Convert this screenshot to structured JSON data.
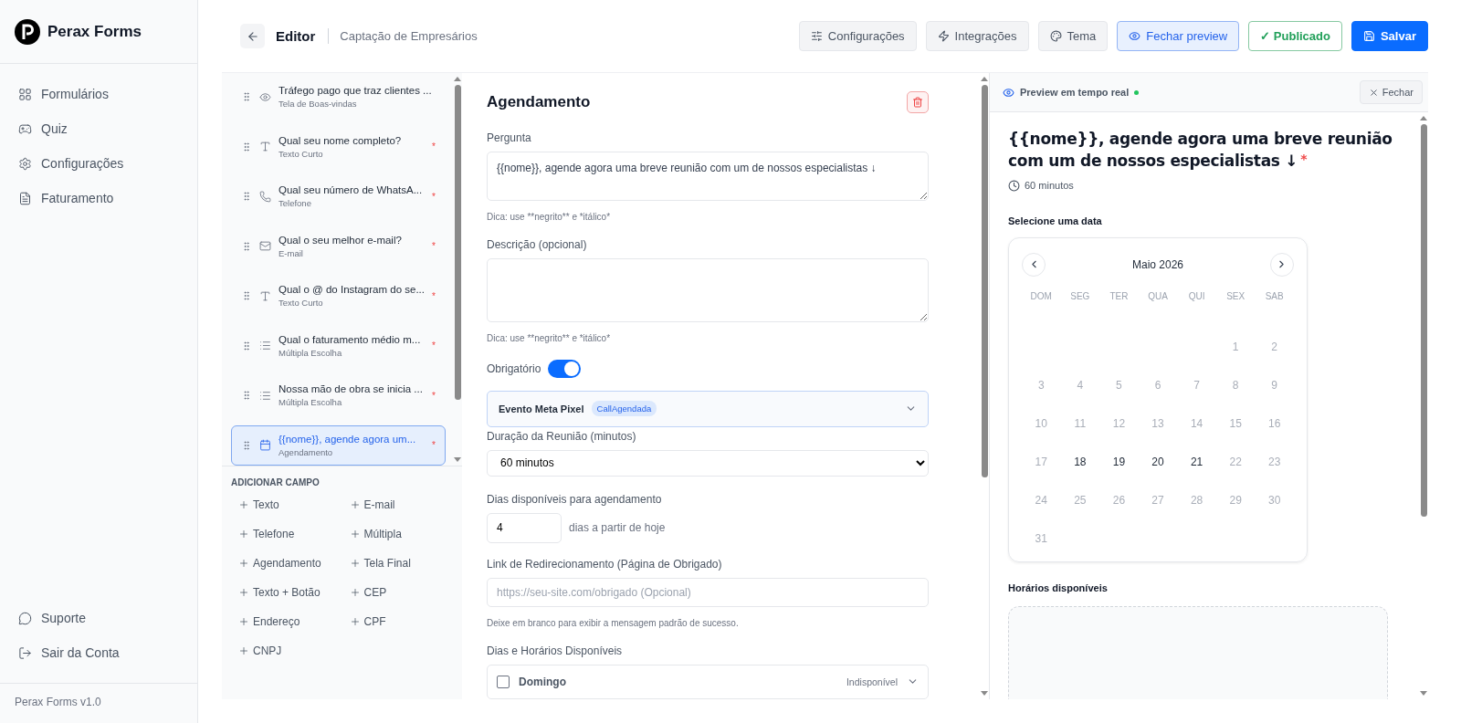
{
  "sidebar": {
    "brand": "Perax Forms",
    "nav": [
      {
        "kind": "grid",
        "label": "Formulários"
      },
      {
        "kind": "game",
        "label": "Quiz"
      },
      {
        "kind": "settings",
        "label": "Configurações"
      },
      {
        "kind": "file",
        "label": "Faturamento"
      }
    ],
    "bottom": [
      {
        "kind": "chat",
        "label": "Suporte"
      },
      {
        "kind": "logout",
        "label": "Sair da Conta"
      }
    ],
    "version": "Perax Forms v1.0"
  },
  "required_mark": "*",
  "header": {
    "title": "Editor",
    "subtitle": "Captação de Empresários",
    "buttons": [
      {
        "kind": "settings",
        "label": "Configurações"
      },
      {
        "kind": "integrations",
        "label": "Integrações"
      },
      {
        "kind": "theme",
        "label": "Tema"
      },
      {
        "kind": "preview",
        "label": "Fechar preview"
      },
      {
        "kind": "published",
        "label": "✓ Publicado"
      },
      {
        "kind": "save",
        "label": "Salvar"
      }
    ]
  },
  "fields": [
    {
      "kind": "welcome",
      "title": "Tráfego pago que traz clientes ...",
      "type": "Tela de Boas-vindas",
      "required": false,
      "selected": false
    },
    {
      "kind": "text",
      "title": "Qual seu nome completo?",
      "type": "Texto Curto",
      "required": true,
      "selected": false
    },
    {
      "kind": "phone",
      "title": "Qual seu número de WhatsA...",
      "type": "Telefone",
      "required": true,
      "selected": false
    },
    {
      "kind": "email",
      "title": "Qual o seu melhor e-mail?",
      "type": "E-mail",
      "required": true,
      "selected": false
    },
    {
      "kind": "text",
      "title": "Qual o @ do Instagram do se...",
      "type": "Texto Curto",
      "required": true,
      "selected": false
    },
    {
      "kind": "choice",
      "title": "Qual o faturamento médio m...",
      "type": "Múltipla Escolha",
      "required": true,
      "selected": false
    },
    {
      "kind": "choice",
      "title": "Nossa mão de obra se inicia ...",
      "type": "Múltipla Escolha",
      "required": true,
      "selected": false
    },
    {
      "kind": "schedule",
      "title": "{{nome}}, agende agora um...",
      "type": "Agendamento",
      "required": true,
      "selected": true
    }
  ],
  "add_field": {
    "title": "ADICIONAR CAMPO",
    "items": [
      "Texto",
      "E-mail",
      "Telefone",
      "Múltipla",
      "Agendamento",
      "Tela Final",
      "Texto + Botão",
      "CEP",
      "Endereço",
      "CPF",
      "CNPJ"
    ]
  },
  "editor": {
    "title": "Agendamento",
    "question_label": "Pergunta",
    "question": "{{nome}}, agende agora uma breve reunião com um de nossos especialistas ↓",
    "question_hint": "Dica: use **negrito** e *itálico*",
    "description_label": "Descrição (opcional)",
    "description_hint": "Dica: use **negrito** e *itálico*",
    "required_label": "Obrigatório",
    "required_on": true,
    "pixel": {
      "label": "Evento Meta Pixel",
      "tag": "CallAgendada"
    },
    "duration_label": "Duração da Reunião (minutos)",
    "duration": "60 minutos",
    "days_label": "Dias disponíveis para agendamento",
    "days_value": "4",
    "days_suffix": "dias a partir de hoje",
    "link_label": "Link de Redirecionamento (Página de Obrigado)",
    "link_placeholder": "https://seu-site.com/obrigado (Opcional)",
    "link_hint": "Deixe em branco para exibir a mensagem padrão de sucesso.",
    "schedule_label": "Dias e Horários Disponíveis",
    "schedule_days": [
      {
        "day": "Domingo",
        "checked": false,
        "status": "Indisponível"
      }
    ]
  },
  "preview": {
    "title": "Preview em tempo real",
    "close": "Fechar",
    "question": "{{nome}}, agende agora uma breve reunião com um de nossos especialistas ↓",
    "required": true,
    "duration": "60 minutos",
    "date_label": "Selecione uma data",
    "month": "Maio 2026",
    "weekdays": [
      "DOM",
      "SEG",
      "TER",
      "QUA",
      "QUI",
      "SEX",
      "SAB"
    ],
    "weeks": [
      [
        {
          "day": "1",
          "disabled": true
        },
        {
          "day": "2",
          "disabled": true
        }
      ],
      [
        {
          "day": "3",
          "disabled": true
        },
        {
          "day": "4",
          "disabled": true
        },
        {
          "day": "5",
          "disabled": true
        },
        {
          "day": "6",
          "disabled": true
        },
        {
          "day": "7",
          "disabled": true
        },
        {
          "day": "8",
          "disabled": true
        },
        {
          "day": "9",
          "disabled": true
        }
      ],
      [
        {
          "day": "10",
          "disabled": true
        },
        {
          "day": "11",
          "disabled": true
        },
        {
          "day": "12",
          "disabled": true
        },
        {
          "day": "13",
          "disabled": true
        },
        {
          "day": "14",
          "disabled": true
        },
        {
          "day": "15",
          "disabled": true
        },
        {
          "day": "16",
          "disabled": true
        }
      ],
      [
        {
          "day": "17",
          "disabled": true
        },
        {
          "day": "18",
          "disabled": false
        },
        {
          "day": "19",
          "disabled": false
        },
        {
          "day": "20",
          "disabled": false
        },
        {
          "day": "21",
          "disabled": false
        },
        {
          "day": "22",
          "disabled": true
        },
        {
          "day": "23",
          "disabled": true
        }
      ],
      [
        {
          "day": "24",
          "disabled": true
        },
        {
          "day": "25",
          "disabled": true
        },
        {
          "day": "26",
          "disabled": true
        },
        {
          "day": "27",
          "disabled": true
        },
        {
          "day": "28",
          "disabled": true
        },
        {
          "day": "29",
          "disabled": true
        },
        {
          "day": "30",
          "disabled": true
        }
      ],
      [
        {
          "day": "31",
          "disabled": true
        }
      ]
    ],
    "times_label": "Horários disponíveis"
  }
}
